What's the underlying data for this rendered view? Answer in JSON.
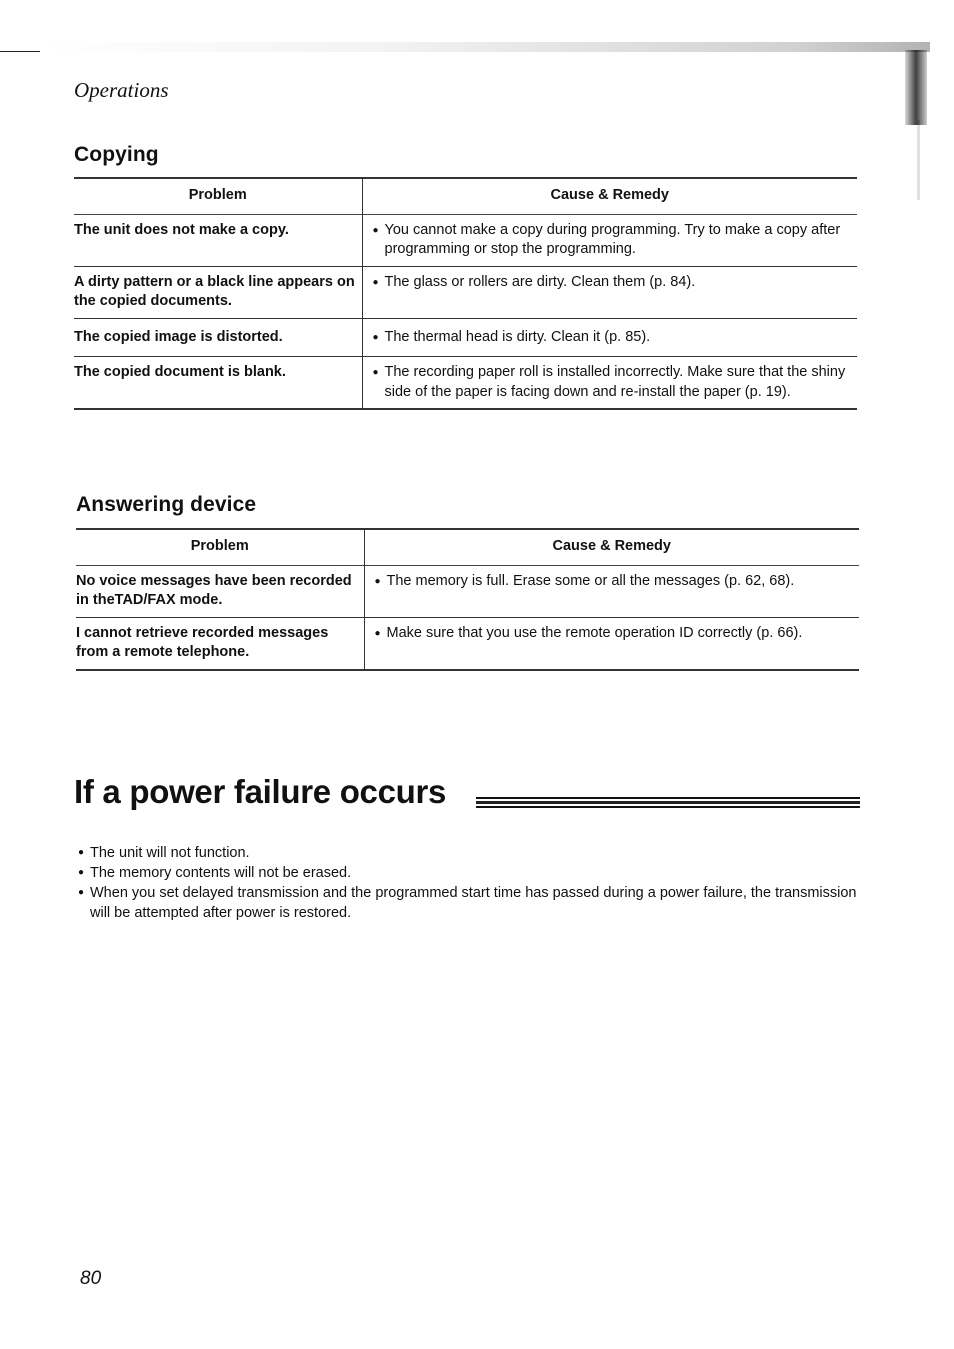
{
  "header": {
    "section_label": "Operations"
  },
  "copying": {
    "title": "Copying",
    "columns": [
      "Problem",
      "Cause & Remedy"
    ],
    "rows": [
      {
        "problem": "The unit does not make a copy.",
        "remedy": "You cannot make a copy during programming. Try to make a copy after programming or stop the programming."
      },
      {
        "problem": "A dirty pattern or a black line appears on the copied documents.",
        "remedy": "The glass or rollers are dirty. Clean them (p. 84)."
      },
      {
        "problem": "The copied image is distorted.",
        "remedy": "The thermal head is dirty. Clean it (p. 85)."
      },
      {
        "problem": "The copied document is blank.",
        "remedy": "The recording paper roll is installed incorrectly. Make sure that the shiny side of the paper is facing down and re-install the paper (p. 19)."
      }
    ]
  },
  "answering_device": {
    "title": "Answering device",
    "columns": [
      "Problem",
      "Cause & Remedy"
    ],
    "rows": [
      {
        "problem": "No voice messages have been recorded in theTAD/FAX mode.",
        "remedy": "The memory is full. Erase some or all the messages (p. 62, 68)."
      },
      {
        "problem": "I cannot retrieve recorded messages from a remote telephone.",
        "remedy": "Make sure that you use the remote operation ID correctly (p. 66)."
      }
    ]
  },
  "power_failure": {
    "title": "If a power failure occurs",
    "items": [
      "The unit will not function.",
      "The memory contents will not be erased.",
      "When you set delayed transmission and the programmed start time has passed during a power failure, the transmission will be attempted after power is restored."
    ]
  },
  "icons": {
    "bullet": "●"
  },
  "footer": {
    "page_number": "80"
  }
}
